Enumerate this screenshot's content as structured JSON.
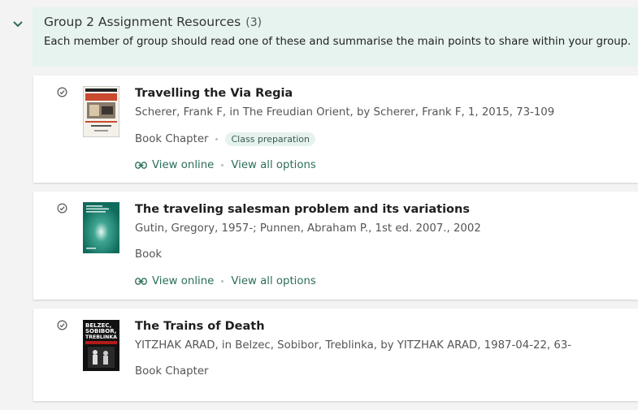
{
  "section": {
    "title": "Group 2 Assignment Resources",
    "count": "(3)",
    "description": "Each member of group should read one of these and summarise the main points to share within your group."
  },
  "items": [
    {
      "title": "Travelling the Via Regia",
      "authors": "Scherer, Frank F, in The Freudian Orient, by Scherer, Frank F, 1, 2015, 73-109",
      "type": "Book Chapter",
      "tag": "Class preparation",
      "view_online": "View online",
      "view_all": "View all options",
      "cover_text": "THE FREUDIAN ORIENT"
    },
    {
      "title": "The traveling salesman problem and its variations",
      "authors": "Gutin, Gregory, 1957-; Punnen, Abraham P., 1st ed. 2007., 2002",
      "type": "Book",
      "view_online": "View online",
      "view_all": "View all options"
    },
    {
      "title": "The Trains of Death",
      "authors": "YITZHAK ARAD, in Belzec, Sobibor, Treblinka, by YITZHAK ARAD, 1987-04-22, 63-",
      "type": "Book Chapter",
      "cover_text": [
        "BELZEC,",
        "SOBIBOR,",
        "TREBLINKA"
      ]
    }
  ],
  "colors": {
    "accent": "#2c6e5b",
    "header_bg": "#e7f3ef",
    "page_bg": "#f3f3f3"
  }
}
